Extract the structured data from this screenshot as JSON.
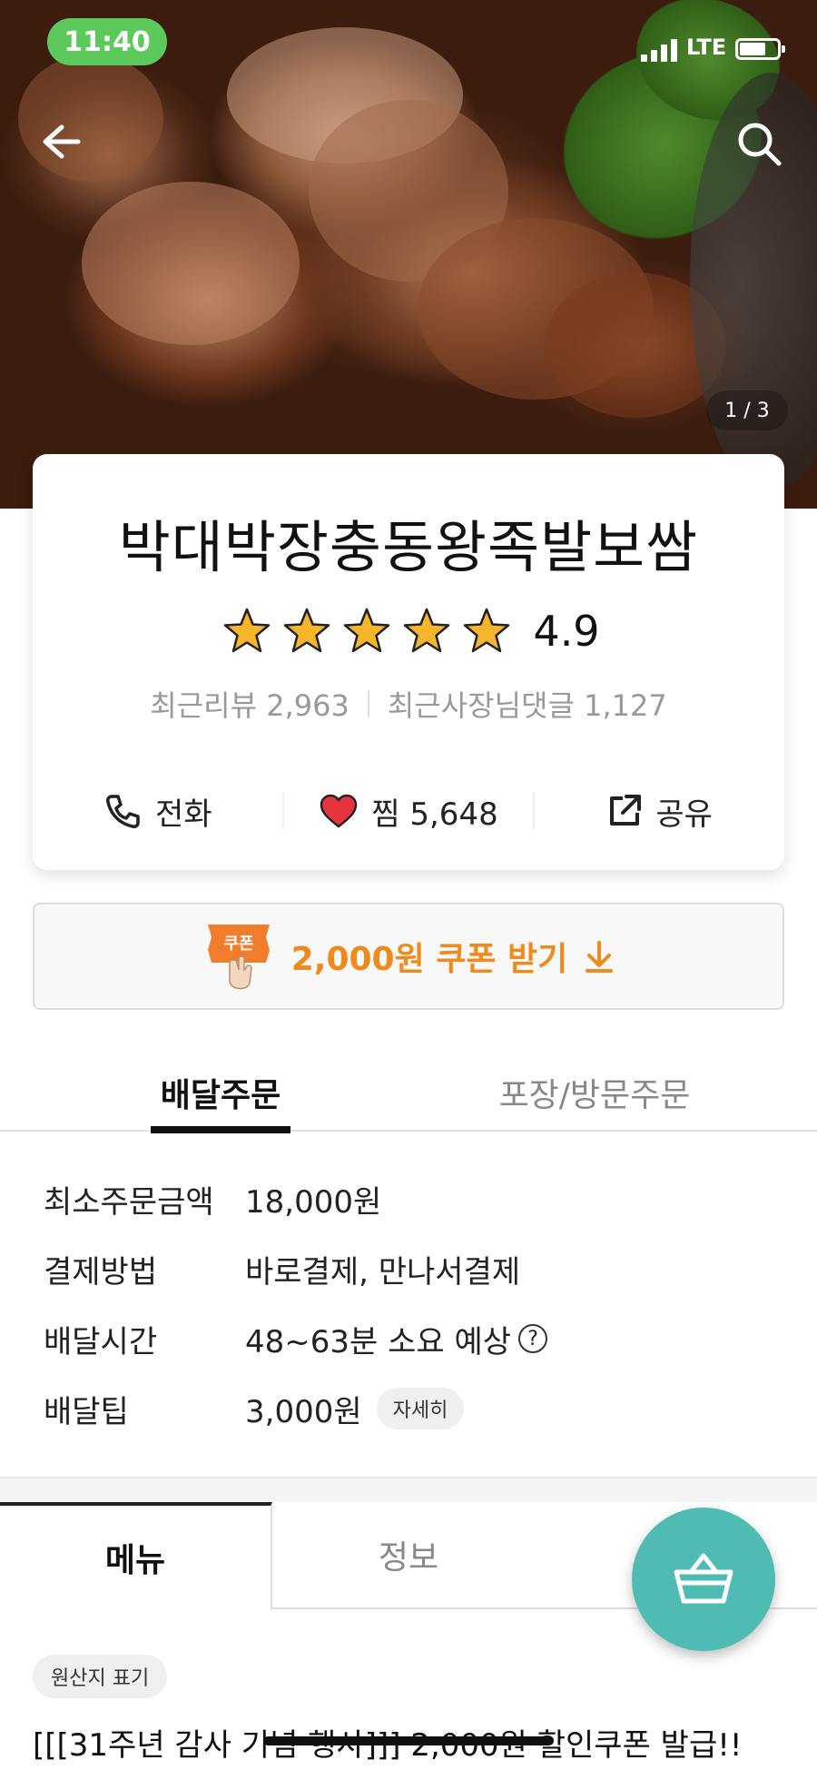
{
  "status_bar": {
    "time": "11:40",
    "network": "LTE",
    "battery_level": 0.7
  },
  "hero": {
    "page_indicator": "1 / 3"
  },
  "store": {
    "name": "박대박장충동왕족발보쌈",
    "rating": "4.9",
    "star_count": 5,
    "recent_reviews": "최근리뷰 2,963",
    "owner_comments": "최근사장님댓글 1,127"
  },
  "actions": {
    "call_label": "전화",
    "favorite_label": "찜 5,648",
    "share_label": "공유"
  },
  "coupon": {
    "badge": "쿠폰",
    "label": "2,000원 쿠폰 받기",
    "accent": "#f08a1c"
  },
  "order_tabs": {
    "delivery": "배달주문",
    "pickup": "포장/방문주문"
  },
  "delivery_info": [
    {
      "key": "최소주문금액",
      "value": "18,000원"
    },
    {
      "key": "결제방법",
      "value": "바로결제, 만나서결제"
    },
    {
      "key": "배달시간",
      "value": "48~63분 소요 예상"
    },
    {
      "key": "배달팁",
      "value": "3,000원"
    }
  ],
  "delivery_help": "?",
  "detail_button": "자세히",
  "menu_tabs": {
    "menu": "메뉴",
    "info": "정보"
  },
  "cart": {
    "icon": "basket-icon",
    "color": "#4fbcb4"
  },
  "origin_chip": "원산지 표기",
  "notice": "[[[31주년 감사 기념 행사]]] 2,000원 할인쿠폰 발급!!"
}
